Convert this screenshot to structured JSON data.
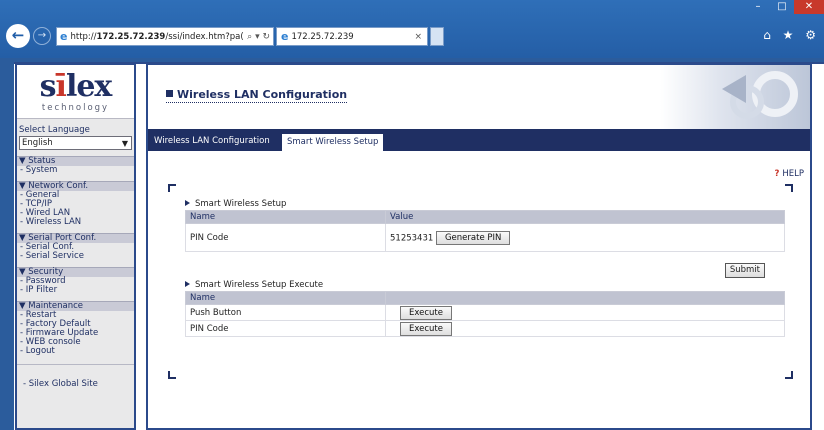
{
  "browser": {
    "url_prefix": "http://",
    "url_host": "172.25.72.239",
    "url_path": "/ssi/index.htm?pa(",
    "address_tools": "⌕ ▾ ↻",
    "tab_title": "172.25.72.239",
    "tab_close": "×",
    "window": {
      "minimize": "–",
      "maximize": "□",
      "close": "✕"
    },
    "toolbar_icons": "⌂ ★ ⚙"
  },
  "sidebar": {
    "logo": {
      "main_prefix": "s",
      "main_dot": "ī",
      "main_rest": "lex",
      "sub": "technology"
    },
    "language_label": "Select Language",
    "language_value": "English",
    "groups": [
      {
        "title": "▼ Status",
        "items": [
          "- System"
        ]
      },
      {
        "title": "▼ Network Conf.",
        "items": [
          "- General",
          "- TCP/IP",
          "- Wired LAN",
          "- Wireless LAN"
        ]
      },
      {
        "title": "▼ Serial Port Conf.",
        "items": [
          "- Serial Conf.",
          "- Serial Service"
        ]
      },
      {
        "title": "▼ Security",
        "items": [
          "- Password",
          "- IP Filter"
        ]
      },
      {
        "title": "▼ Maintenance",
        "items": [
          "- Restart",
          "- Factory Default",
          "- Firmware Update",
          "- WEB console",
          "- Logout"
        ]
      }
    ],
    "global_site": "- Silex Global Site"
  },
  "header": {
    "title": "Wireless LAN Configuration"
  },
  "tabs": [
    {
      "label": "Wireless LAN Configuration"
    },
    {
      "label": "Smart Wireless Setup"
    }
  ],
  "help_label": "HELP",
  "setup": {
    "title": "Smart Wireless Setup",
    "col_name": "Name",
    "col_value": "Value",
    "pin_label": "PIN Code",
    "pin_value": "51253431",
    "generate_label": "Generate PIN"
  },
  "submit_label": "Submit",
  "execute_section": {
    "title": "Smart Wireless Setup Execute",
    "col_name": "Name",
    "rows": [
      {
        "name": "Push Button",
        "button": "Execute"
      },
      {
        "name": "PIN Code",
        "button": "Execute"
      }
    ]
  }
}
